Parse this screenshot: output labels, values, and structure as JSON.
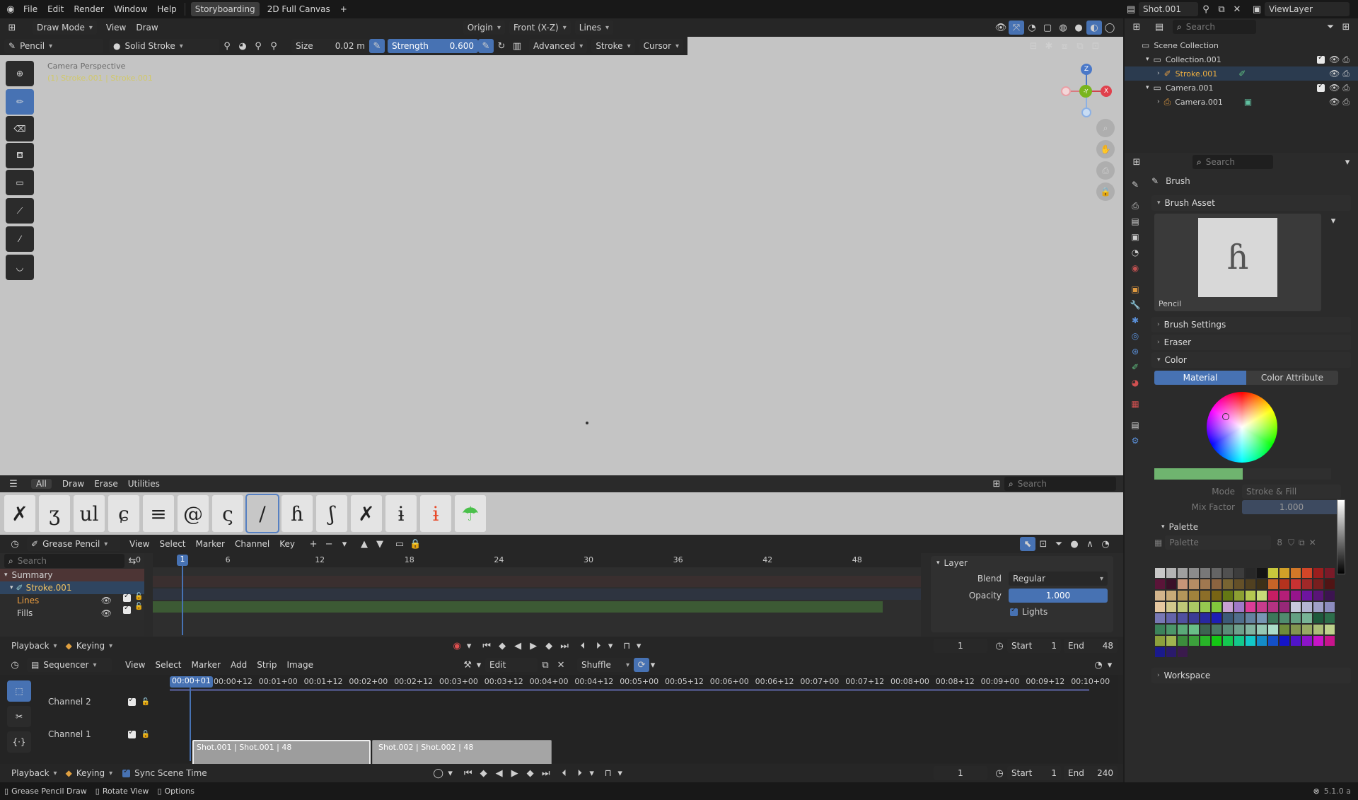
{
  "topbar": {
    "menus": [
      "File",
      "Edit",
      "Render",
      "Window",
      "Help"
    ],
    "workspaces": [
      "Storyboarding",
      "2D Full Canvas"
    ],
    "add_ws": "+",
    "scene": "Shot.001",
    "viewlayer": "ViewLayer"
  },
  "viewport": {
    "mode": "Draw Mode",
    "menus": [
      "View",
      "Draw"
    ],
    "origin": "Origin",
    "view": "Front (X-Z)",
    "lines": "Lines",
    "brush": "Pencil",
    "stroke_mat": "Solid Stroke",
    "size_label": "Size",
    "size_val": "0.02 m",
    "strength_label": "Strength",
    "strength_val": "0.600",
    "advanced": "Advanced",
    "stroke": "Stroke",
    "cursor": "Cursor",
    "overlay1": "Camera Perspective",
    "overlay2": "(1) Stroke.001 | Stroke.001",
    "gizmo": {
      "z": "Z",
      "y": "-Y",
      "x": "X"
    }
  },
  "brush_shelf": {
    "tabs": [
      "All",
      "Draw",
      "Erase",
      "Utilities"
    ],
    "search_ph": "Search",
    "glyphs": [
      "✗",
      "ʒ",
      "ul",
      "ɕ",
      "≡",
      "@",
      "ς",
      "/",
      "ɦ",
      "ʃ",
      "✗",
      "ɨ",
      "ɨ",
      "☂"
    ]
  },
  "dopesheet": {
    "editor": "Grease Pencil",
    "menus": [
      "View",
      "Select",
      "Marker",
      "Channel",
      "Key"
    ],
    "search_ph": "Search",
    "frame_ticks": [
      "0",
      "1",
      "6",
      "12",
      "18",
      "24",
      "30",
      "36",
      "42",
      "48"
    ],
    "channels": [
      {
        "name": "Summary"
      },
      {
        "name": "Stroke.001"
      },
      {
        "name": "Lines"
      },
      {
        "name": "Fills"
      }
    ],
    "layer_panel": {
      "title": "Layer",
      "blend_label": "Blend",
      "blend_val": "Regular",
      "opacity_label": "Opacity",
      "opacity_val": "1.000",
      "lights": "Lights"
    },
    "playback": "Playback",
    "keying": "Keying",
    "frame": "1",
    "start_label": "Start",
    "start": "1",
    "end_label": "End",
    "end": "48"
  },
  "sequencer": {
    "editor": "Sequencer",
    "menus": [
      "View",
      "Select",
      "Marker",
      "Add",
      "Strip",
      "Image"
    ],
    "edit": "Edit",
    "shuffle": "Shuffle",
    "current_time": "00:00+01",
    "ticks": [
      "00:00+12",
      "00:01+00",
      "00:01+12",
      "00:02+00",
      "00:02+12",
      "00:03+00",
      "00:03+12",
      "00:04+00",
      "00:04+12",
      "00:05+00",
      "00:05+12",
      "00:06+00",
      "00:06+12",
      "00:07+00",
      "00:07+12",
      "00:08+00",
      "00:08+12",
      "00:09+00",
      "00:09+12",
      "00:10+00"
    ],
    "channels": [
      "Channel 2",
      "Channel 1"
    ],
    "strips": [
      "Shot.001 | Shot.001 | 48",
      "Shot.002 | Shot.002 | 48"
    ],
    "playback": "Playback",
    "keying": "Keying",
    "sync": "Sync Scene Time",
    "frame": "1",
    "start_label": "Start",
    "start": "1",
    "end_label": "End",
    "end": "240"
  },
  "outliner": {
    "search_ph": "Search",
    "items": [
      "Scene Collection",
      "Collection.001",
      "Stroke.001",
      "Camera.001",
      "Camera.001"
    ]
  },
  "properties": {
    "search_ph": "Search",
    "title": "Brush",
    "brush_asset": "Brush Asset",
    "brush_name": "Pencil",
    "sections": [
      "Brush Settings",
      "Eraser",
      "Color"
    ],
    "color_tabs": [
      "Material",
      "Color Attribute"
    ],
    "mode_label": "Mode",
    "mode_val": "Stroke & Fill",
    "mix_label": "Mix Factor",
    "mix_val": "1.000",
    "palette": "Palette",
    "palette_name": "Palette",
    "palette_count": "8",
    "workspace": "Workspace"
  },
  "statusbar": {
    "items": [
      "Grease Pencil Draw",
      "Rotate View",
      "Options"
    ],
    "version": "5.1.0 a"
  },
  "colors": {
    "accent": "#4772b3",
    "viewport_bg": "#c4c4c4",
    "strip1": "#9d9d9d",
    "strip2": "#a5a5a5"
  }
}
